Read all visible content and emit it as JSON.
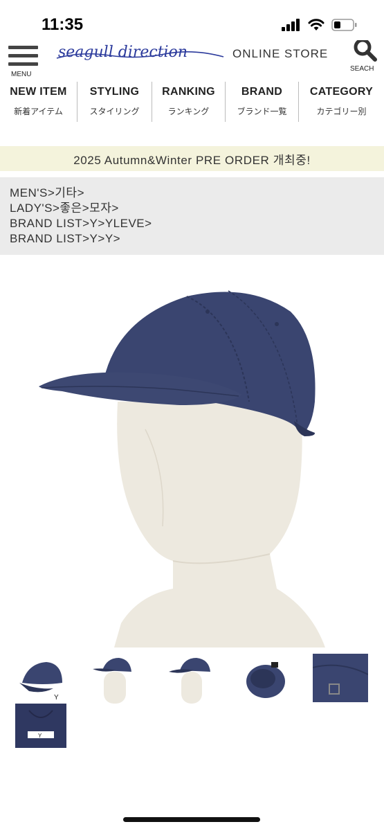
{
  "status_bar": {
    "time": "11:35",
    "icons": [
      "cellular-signal-icon",
      "wifi-icon",
      "battery-icon"
    ]
  },
  "header": {
    "menu_label": "MENU",
    "logo_text": "seagull direction",
    "store_label": "ONLINE STORE",
    "search_label": "SEACH"
  },
  "nav": [
    {
      "en": "NEW ITEM",
      "jp": "新着アイテム"
    },
    {
      "en": "STYLING",
      "jp": "スタイリング"
    },
    {
      "en": "RANKING",
      "jp": "ランキング"
    },
    {
      "en": "BRAND",
      "jp": "ブランド一覧"
    },
    {
      "en": "CATEGORY",
      "jp": "カテゴリー別"
    }
  ],
  "banner": {
    "text": "2025 Autumn&Winter PRE ORDER 개최중!"
  },
  "breadcrumbs": [
    "MEN'S>기타>",
    "LADY'S>좋은>모자>",
    "BRAND LIST>Y>YLEVE>",
    "BRAND LIST>Y>Y>"
  ],
  "product": {
    "label_text": "Y"
  },
  "colors": {
    "cap_navy": "#3a4570",
    "banner_bg": "#f4f3dc",
    "crumb_bg": "#ebebeb",
    "logo_blue": "#2b3a9c"
  }
}
